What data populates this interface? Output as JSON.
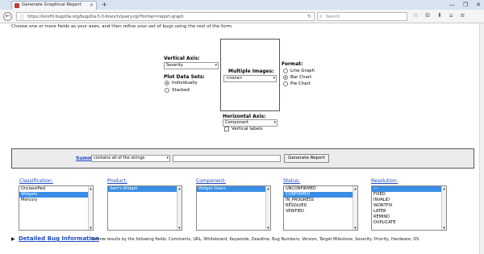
{
  "browser": {
    "tab_title": "Generate Graphical Report",
    "tab_close": "×",
    "new_tab": "+",
    "window_controls": [
      "—",
      "❐",
      "✕"
    ],
    "back": "←",
    "url_prefix": "https://",
    "url_host": "bugzilla",
    "url_rest": "lorxfill.bugzilla.org/bugzilla-5.0-branch/query.cgi?format=report-graph",
    "search_placeholder": "Search",
    "reload": "↻",
    "toolbar_icons": [
      "☆",
      "⊟",
      "⬇",
      "⌂",
      "≡"
    ]
  },
  "intro": "Choose one or more fields as your axes, and then refine your set of bugs using the rest of the form.",
  "vertical_axis": {
    "label": "Vertical Axis:",
    "value": "Severity"
  },
  "plot_data_sets": {
    "label": "Plot Data Sets:",
    "options": [
      {
        "label": "Individually",
        "checked": true
      },
      {
        "label": "Stacked",
        "checked": false
      }
    ]
  },
  "multiple_images": {
    "label": "Multiple Images:",
    "value": "<none>"
  },
  "format": {
    "label": "Format:",
    "options": [
      {
        "label": "Line Graph",
        "checked": false
      },
      {
        "label": "Bar Chart",
        "checked": true
      },
      {
        "label": "Pie Chart",
        "checked": false
      }
    ]
  },
  "horizontal_axis": {
    "label": "Horizontal Axis:",
    "value": "Component",
    "vertical_labels": "Vertical labels"
  },
  "summary": {
    "label": "Summary:",
    "operator": "contains all of the strings",
    "value": "",
    "button": "Generate Report"
  },
  "fields": {
    "classification": {
      "label": "Classification:",
      "options": [
        "Unclassified",
        "Widgets",
        "Mercury"
      ],
      "selected": 1
    },
    "product": {
      "label": "Product:",
      "options": [
        "Sam's Widget"
      ],
      "selected": 0
    },
    "component": {
      "label": "Component:",
      "options": [
        "Widget Gears"
      ],
      "selected": 0
    },
    "status": {
      "label": "Status:",
      "options": [
        "UNCONFIRMED",
        "CONFIRMED",
        "IN_PROGRESS",
        "RESOLVED",
        "VERIFIED"
      ],
      "selected": 1
    },
    "resolution": {
      "label": "Resolution:",
      "options": [
        "---",
        "FIXED",
        "INVALID",
        "WONTFIX",
        "LATER",
        "REMIND",
        "DUPLICATE"
      ],
      "selected": 0
    }
  },
  "detailed": {
    "arrow": "▶",
    "label": "Detailed Bug Information",
    "description": "Narrow results by the following fields: Comments, URL, Whiteboard, Keywords, Deadline, Bug Numbers, Version, Target Milestone, Severity, Priority, Hardware, OS"
  },
  "colors": {
    "link": "#1f49c5",
    "selection": "#3a8ee6"
  }
}
